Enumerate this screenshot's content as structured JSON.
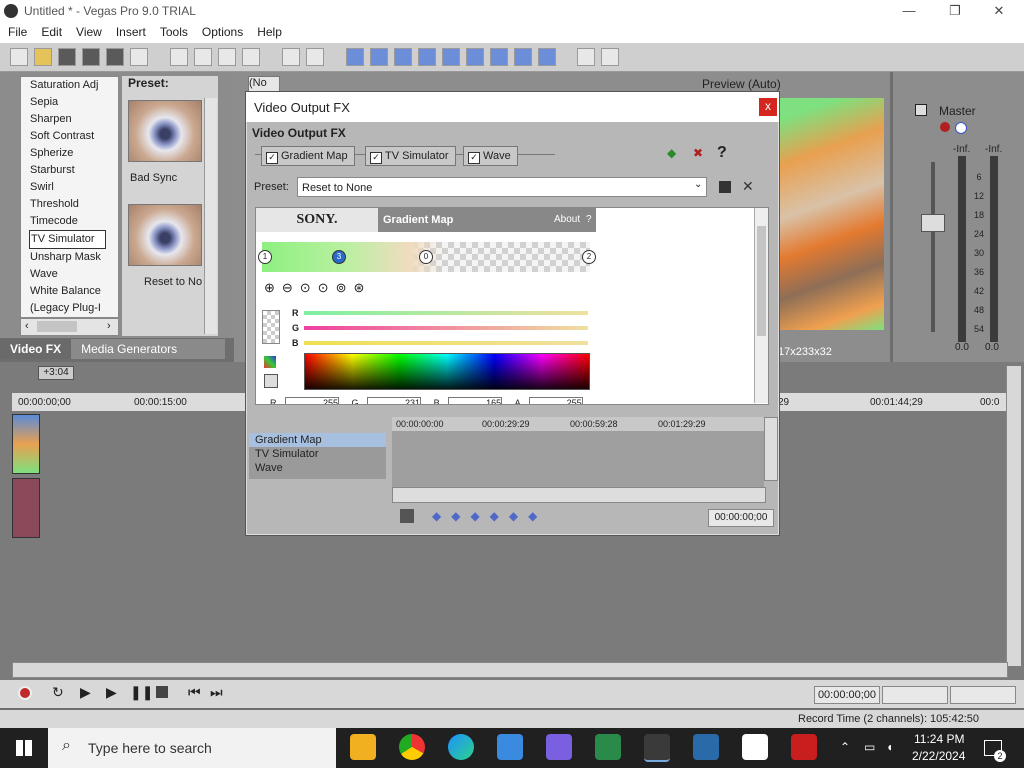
{
  "window": {
    "title": "Untitled * - Vegas Pro 9.0 TRIAL",
    "minimize": "—",
    "maximize": "❐",
    "close": "✕"
  },
  "menu": [
    "File",
    "Edit",
    "View",
    "Insert",
    "Tools",
    "Options",
    "Help"
  ],
  "fx_panel": {
    "items": [
      "Saturation Adj",
      "Sepia",
      "Sharpen",
      "Soft Contrast",
      "Spherize",
      "Starburst",
      "Swirl",
      "Threshold",
      "Timecode",
      "TV Simulator",
      "Unsharp Mask",
      "Wave",
      "White Balance",
      "(Legacy Plug-I"
    ],
    "selected": "TV Simulator",
    "preset_label": "Preset:",
    "presets": [
      "Bad Sync",
      "Reset to No"
    ],
    "tabs": [
      "Video FX",
      "Media Generators"
    ]
  },
  "preview": {
    "mode": "Preview (Auto)",
    "resolution": "17x233x32",
    "zoom_box": "(No"
  },
  "mixer": {
    "label": "Master",
    "inf_left": "-Inf.",
    "inf_right": "-Inf.",
    "scale": [
      "6",
      "12",
      "18",
      "24",
      "30",
      "36",
      "42",
      "48",
      "54"
    ],
    "bottom_left": "0.0",
    "bottom_right": "0.0"
  },
  "timeline": {
    "badge": "+3:04",
    "ruler": [
      "00:00:00;00",
      "00:00:15:00",
      "29",
      "00:01:44;29",
      "00:0"
    ],
    "time_display": "00:00:00;00",
    "record_time": "Record Time (2 channels): 105:42:50"
  },
  "dialog": {
    "title": "Video Output FX",
    "close": "x",
    "subtitle": "Video Output FX",
    "chain": [
      "Gradient Map",
      "TV Simulator",
      "Wave"
    ],
    "help": "?",
    "preset_label": "Preset:",
    "preset_value": "Reset to None",
    "plugin": {
      "brand": "SONY.",
      "name": "Gradient Map",
      "about": "About",
      "about_q": "?",
      "stops": [
        "1",
        "3",
        "0",
        "2"
      ],
      "channels": [
        "R",
        "G",
        "B"
      ],
      "fields": [
        "R",
        "255",
        "G",
        "231",
        "B",
        "165",
        "A",
        "255"
      ]
    },
    "tracks": [
      "Gradient Map",
      "TV Simulator",
      "Wave"
    ],
    "kf_ruler": [
      "00:00:00:00",
      "00:00:29:29",
      "00:00:59:28",
      "00:01:29:29"
    ],
    "kf_time": "00:00:00;00"
  },
  "taskbar": {
    "search_placeholder": "Type here to search",
    "time": "11:24 PM",
    "date": "2/22/2024",
    "notif_badge": "2"
  }
}
